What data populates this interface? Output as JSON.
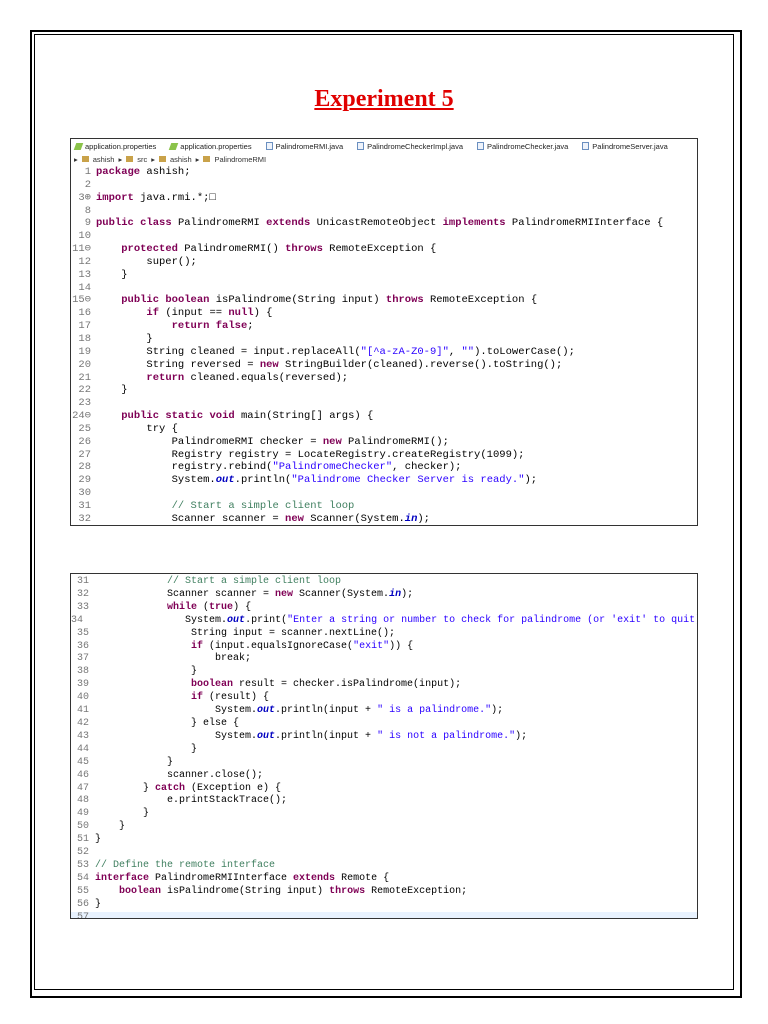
{
  "title": "Experiment 5",
  "editor": {
    "tabs": [
      "application.properties",
      "application.properties",
      "PalindromeRMI.java",
      "PalindromeCheckerImpl.java",
      "PalindromeChecker.java",
      "PalindromeServer.java"
    ],
    "tab_icons": [
      "properties-icon",
      "properties-icon",
      "java-file-icon",
      "java-file-icon",
      "java-file-icon",
      "java-file-icon"
    ],
    "breadcrumb": [
      "ashish",
      "src",
      "ashish",
      "PalindromeRMI"
    ]
  },
  "snippet1": [
    {
      "n": "1",
      "t": "package ashish;"
    },
    {
      "n": "2",
      "t": ""
    },
    {
      "n": "3⊕",
      "t": "import java.rmi.*;□"
    },
    {
      "n": "8",
      "t": ""
    },
    {
      "n": "9",
      "t": "public class PalindromeRMI extends UnicastRemoteObject implements PalindromeRMIInterface {"
    },
    {
      "n": "10",
      "t": ""
    },
    {
      "n": "11⊖",
      "t": "    protected PalindromeRMI() throws RemoteException {"
    },
    {
      "n": "12",
      "t": "        super();"
    },
    {
      "n": "13",
      "t": "    }"
    },
    {
      "n": "14",
      "t": ""
    },
    {
      "n": "15⊖",
      "t": "    public boolean isPalindrome(String input) throws RemoteException {"
    },
    {
      "n": "16",
      "t": "        if (input == null) {"
    },
    {
      "n": "17",
      "t": "            return false;"
    },
    {
      "n": "18",
      "t": "        }"
    },
    {
      "n": "19",
      "t": "        String cleaned = input.replaceAll(\"[^a-zA-Z0-9]\", \"\").toLowerCase();"
    },
    {
      "n": "20",
      "t": "        String reversed = new StringBuilder(cleaned).reverse().toString();"
    },
    {
      "n": "21",
      "t": "        return cleaned.equals(reversed);"
    },
    {
      "n": "22",
      "t": "    }"
    },
    {
      "n": "23",
      "t": ""
    },
    {
      "n": "24⊖",
      "t": "    public static void main(String[] args) {"
    },
    {
      "n": "25",
      "t": "        try {"
    },
    {
      "n": "26",
      "t": "            PalindromeRMI checker = new PalindromeRMI();"
    },
    {
      "n": "27",
      "t": "            Registry registry = LocateRegistry.createRegistry(1099);"
    },
    {
      "n": "28",
      "t": "            registry.rebind(\"PalindromeChecker\", checker);"
    },
    {
      "n": "29",
      "t": "            System.out.println(\"Palindrome Checker Server is ready.\");"
    },
    {
      "n": "30",
      "t": ""
    },
    {
      "n": "31",
      "t": "            // Start a simple client loop"
    },
    {
      "n": "32",
      "t": "            Scanner scanner = new Scanner(System.in);"
    }
  ],
  "snippet2": [
    {
      "n": "31",
      "t": "            // Start a simple client loop"
    },
    {
      "n": "32",
      "t": "            Scanner scanner = new Scanner(System.in);"
    },
    {
      "n": "33",
      "t": "            while (true) {"
    },
    {
      "n": "34",
      "t": "                System.out.print(\"Enter a string or number to check for palindrome (or 'exit' to quit): \");"
    },
    {
      "n": "35",
      "t": "                String input = scanner.nextLine();"
    },
    {
      "n": "36",
      "t": "                if (input.equalsIgnoreCase(\"exit\")) {"
    },
    {
      "n": "37",
      "t": "                    break;"
    },
    {
      "n": "38",
      "t": "                }"
    },
    {
      "n": "39",
      "t": "                boolean result = checker.isPalindrome(input);"
    },
    {
      "n": "40",
      "t": "                if (result) {"
    },
    {
      "n": "41",
      "t": "                    System.out.println(input + \" is a palindrome.\");"
    },
    {
      "n": "42",
      "t": "                } else {"
    },
    {
      "n": "43",
      "t": "                    System.out.println(input + \" is not a palindrome.\");"
    },
    {
      "n": "44",
      "t": "                }"
    },
    {
      "n": "45",
      "t": "            }"
    },
    {
      "n": "46",
      "t": "            scanner.close();"
    },
    {
      "n": "47",
      "t": "        } catch (Exception e) {"
    },
    {
      "n": "48",
      "t": "            e.printStackTrace();"
    },
    {
      "n": "49",
      "t": "        }"
    },
    {
      "n": "50",
      "t": "    }"
    },
    {
      "n": "51",
      "t": "}"
    },
    {
      "n": "52",
      "t": ""
    },
    {
      "n": "53",
      "t": "// Define the remote interface"
    },
    {
      "n": "54",
      "t": "interface PalindromeRMIInterface extends Remote {"
    },
    {
      "n": "55",
      "t": "    boolean isPalindrome(String input) throws RemoteException;"
    },
    {
      "n": "56",
      "t": "}"
    },
    {
      "n": "57",
      "t": ""
    }
  ]
}
